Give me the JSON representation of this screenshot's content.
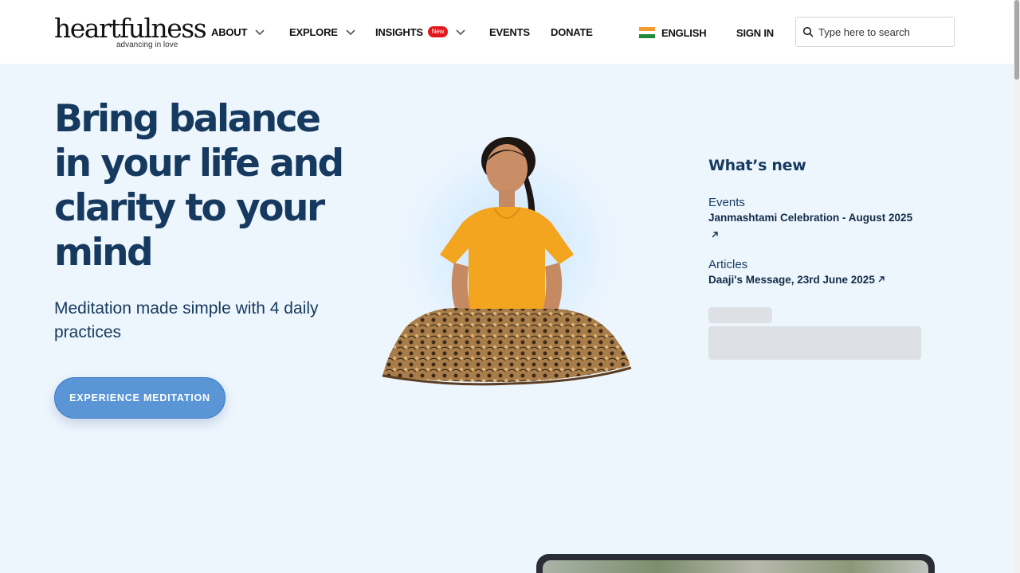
{
  "header": {
    "logo_main": "heartfulness",
    "logo_sub": "advancing in love",
    "nav": {
      "about": "ABOUT",
      "explore": "EXPLORE",
      "insights": "INSIGHTS",
      "insights_badge": "New",
      "events": "EVENTS",
      "donate": "DONATE"
    },
    "language": "ENGLISH",
    "sign_in": "SIGN IN",
    "search_placeholder": "Type here to search"
  },
  "hero": {
    "title": "Bring balance in your life and clarity to your mind",
    "subtitle": "Meditation made simple with 4 daily practices",
    "cta": "EXPERIENCE MEDITATION"
  },
  "whats_new": {
    "title": "What’s new",
    "items": [
      {
        "category": "Events",
        "link": "Janmashtami Celebration - August 2025"
      },
      {
        "category": "Articles",
        "link": "Daaji's Message, 23rd June 2025"
      }
    ]
  },
  "colors": {
    "page_bg": "#eef6fd",
    "header_bg": "#ffffff",
    "heading": "#163a5f",
    "cta_bg": "#5a96d6",
    "badge": "#e3161b"
  },
  "icons": [
    "chevron-down-icon",
    "india-flag-icon",
    "search-icon",
    "external-arrow-icon"
  ]
}
